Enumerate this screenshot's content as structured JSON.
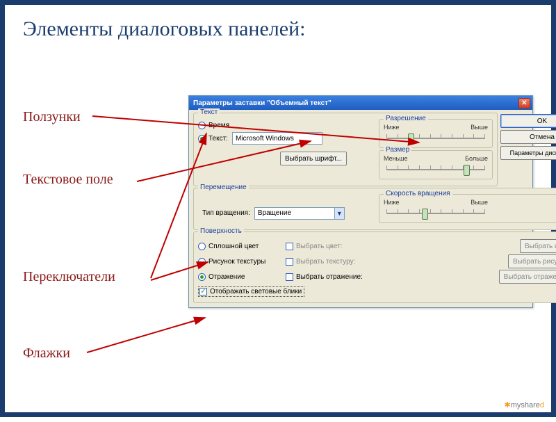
{
  "slide": {
    "title": "Элементы диалоговых панелей:",
    "labels": {
      "sliders": "Ползунки",
      "textfield": "Текстовое поле",
      "radios": "Переключатели",
      "checkboxes": "Флажки"
    },
    "watermark_a": "myshare",
    "watermark_b": "d"
  },
  "dialog": {
    "title": "Параметры заставки \"Объемный текст\"",
    "close": "✕",
    "buttons": {
      "ok": "OK",
      "cancel": "Отмена",
      "display": "Параметры дисплея..."
    },
    "groups": {
      "text": {
        "legend": "Текст",
        "radio_time": "Время",
        "radio_text": "Текст:",
        "text_value": "Microsoft Windows",
        "choose_font": "Выбрать шрифт...",
        "resolution": {
          "legend": "Разрешение",
          "low": "Ниже",
          "high": "Выше"
        },
        "size": {
          "legend": "Размер",
          "low": "Меньше",
          "high": "Больше"
        }
      },
      "movement": {
        "legend": "Перемещение",
        "rotation_label": "Тип вращения:",
        "rotation_value": "Вращение",
        "speed": {
          "legend": "Скорость вращения",
          "low": "Ниже",
          "high": "Выше"
        }
      },
      "surface": {
        "legend": "Поверхность",
        "radio_solid": "Сплошной цвет",
        "radio_texture": "Рисунок текстуры",
        "radio_reflection": "Отражение",
        "chk_color": "Выбрать цвет:",
        "chk_texture": "Выбрать текстуру:",
        "chk_reflection": "Выбрать отражение:",
        "btn_color": "Выбрать цвет...",
        "btn_texture": "Выбрать рисунок...",
        "btn_reflection": "Выбрать отражение...",
        "chk_flares": "Отображать световые блики"
      }
    }
  }
}
